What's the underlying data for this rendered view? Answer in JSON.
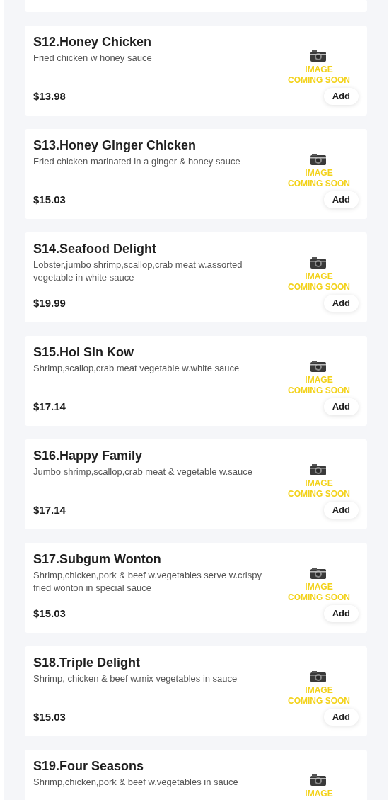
{
  "items": [
    {
      "kind": "partial"
    },
    {
      "kind": "full",
      "name": "S12.Honey Chicken",
      "description": "Fried chicken w honey sauce",
      "price": "$13.98",
      "image_lines": [
        "IMAGE",
        "COMING SOON"
      ],
      "button": "Add"
    },
    {
      "kind": "full",
      "name": "S13.Honey Ginger Chicken",
      "description": "Fried chicken marinated in a ginger & honey sauce",
      "price": "$15.03",
      "image_lines": [
        "IMAGE",
        "COMING SOON"
      ],
      "button": "Add"
    },
    {
      "kind": "full",
      "name": "S14.Seafood Delight",
      "description": "Lobster,jumbo shrimp,scallop,crab meat w.assorted vegetable in white sauce",
      "price": "$19.99",
      "image_lines": [
        "IMAGE",
        "COMING SOON"
      ],
      "button": "Add"
    },
    {
      "kind": "full",
      "name": "S15.Hoi Sin Kow",
      "description": "Shrimp,scallop,crab meat vegetable w.white sauce",
      "price": "$17.14",
      "image_lines": [
        "IMAGE",
        "COMING SOON"
      ],
      "button": "Add"
    },
    {
      "kind": "full",
      "name": "S16.Happy Family",
      "description": "Jumbo shrimp,scallop,crab meat & vegetable w.sauce",
      "price": "$17.14",
      "image_lines": [
        "IMAGE",
        "COMING SOON"
      ],
      "button": "Add"
    },
    {
      "kind": "full",
      "name": "S17.Subgum Wonton",
      "description": "Shrimp,chicken,pork & beef w.vegetables serve w.crispy fried wonton in special sauce",
      "price": "$15.03",
      "image_lines": [
        "IMAGE",
        "COMING SOON"
      ],
      "button": "Add"
    },
    {
      "kind": "full",
      "name": "S18.Triple Delight",
      "description": "Shrimp, chicken & beef w.mix vegetables in sauce",
      "price": "$15.03",
      "image_lines": [
        "IMAGE",
        "COMING SOON"
      ],
      "button": "Add"
    },
    {
      "kind": "full",
      "name": "S19.Four Seasons",
      "description": "Shrimp,chicken,pork & beef w.vegetables in sauce",
      "image_lines": [
        "IMAGE"
      ]
    }
  ]
}
